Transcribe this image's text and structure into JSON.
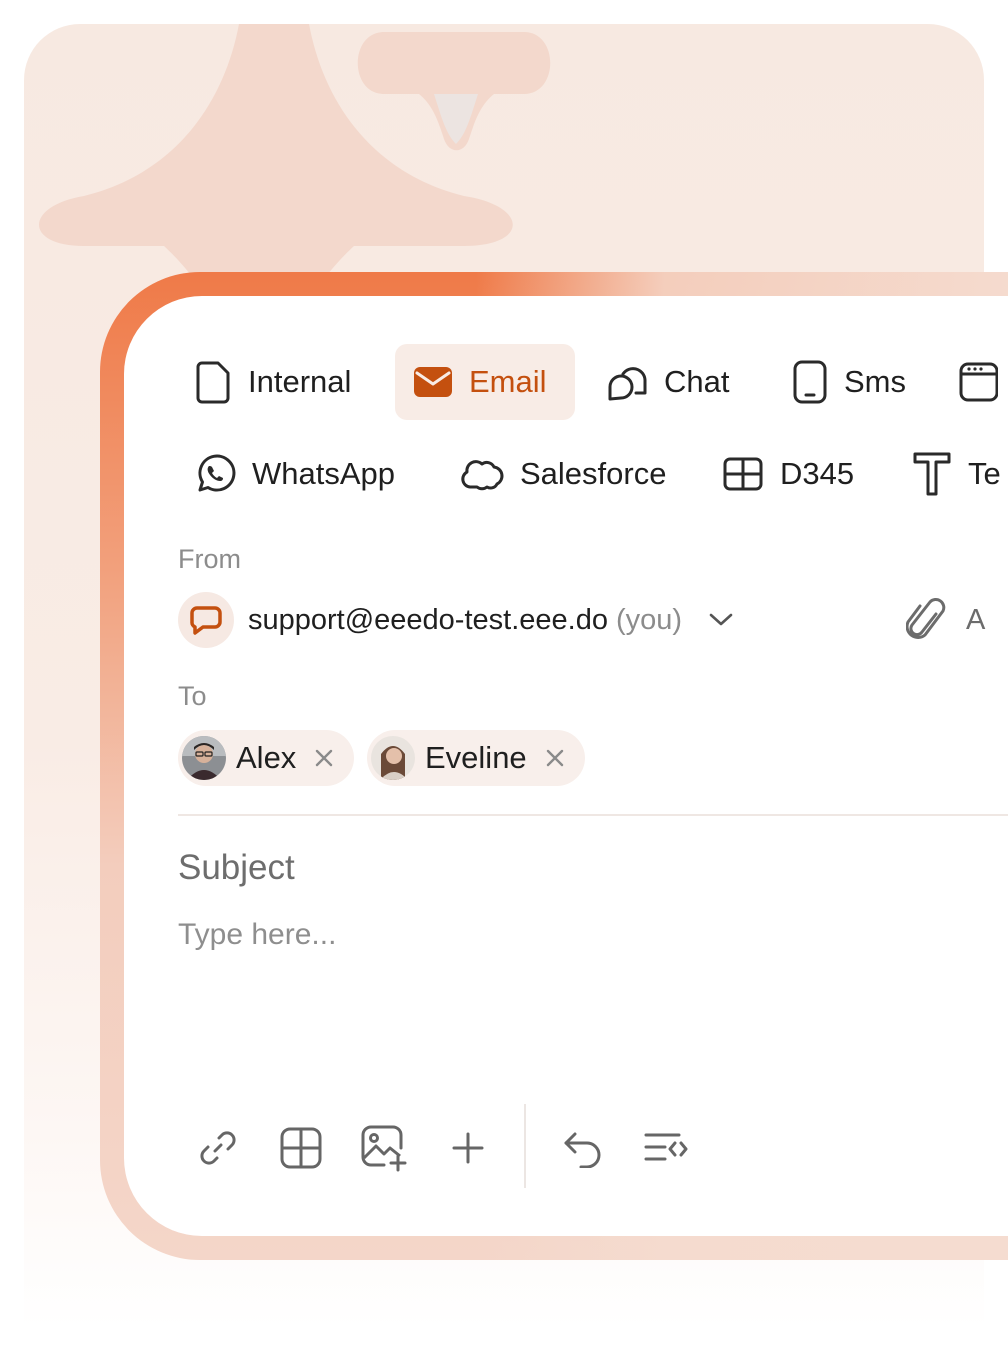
{
  "colors": {
    "accent": "#c4500f",
    "accent_bg": "#f8ece6",
    "text_primary": "#1f1f1f",
    "text_muted": "#8c8c8c",
    "chip_bg": "#f8efeb",
    "frame_bg": "#f7e9e1"
  },
  "channels": {
    "row1": [
      {
        "label": "Internal",
        "icon": "document-icon",
        "active": false
      },
      {
        "label": "Email",
        "icon": "envelope-icon",
        "active": true
      },
      {
        "label": "Chat",
        "icon": "chat-bubbles-icon",
        "active": false
      },
      {
        "label": "Sms",
        "icon": "phone-icon",
        "active": false
      },
      {
        "label": "",
        "icon": "calendar-icon",
        "active": false
      }
    ],
    "row2": [
      {
        "label": "WhatsApp",
        "icon": "whatsapp-icon"
      },
      {
        "label": "Salesforce",
        "icon": "cloud-icon"
      },
      {
        "label": "D345",
        "icon": "grid-icon"
      },
      {
        "label": "Te",
        "icon": "text-t-icon"
      }
    ]
  },
  "from": {
    "label": "From",
    "email": "support@eeedo-test.eee.do",
    "suffix": "(you)",
    "avatar_icon": "chat-square-icon",
    "dropdown_icon": "chevron-down-icon"
  },
  "attachment": {
    "icon": "paperclip-icon",
    "label": "A"
  },
  "to": {
    "label": "To",
    "recipients": [
      {
        "name": "Alex",
        "avatar": "avatar-alex"
      },
      {
        "name": "Eveline",
        "avatar": "avatar-eveline"
      }
    ]
  },
  "subject": {
    "placeholder": "Subject"
  },
  "body": {
    "placeholder": "Type here..."
  },
  "toolbar": [
    {
      "icon": "link-icon"
    },
    {
      "icon": "table-icon"
    },
    {
      "icon": "add-image-icon"
    },
    {
      "icon": "plus-icon"
    },
    {
      "icon": "undo-icon"
    },
    {
      "icon": "code-format-icon"
    }
  ]
}
